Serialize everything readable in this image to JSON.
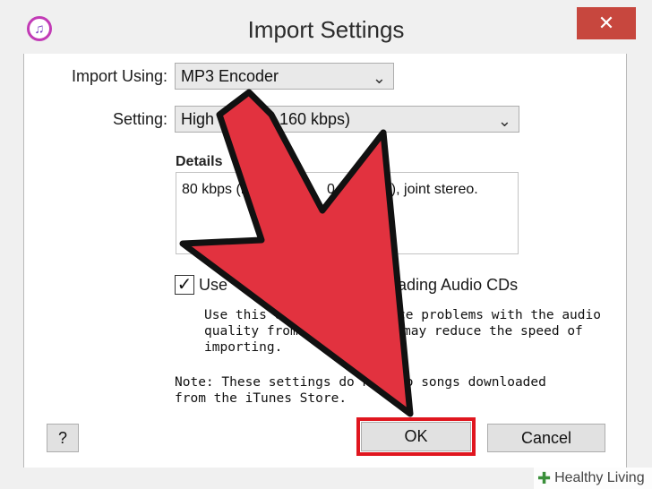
{
  "window": {
    "title": "Import Settings",
    "app_icon_glyph": "♫",
    "close_glyph": "✕"
  },
  "form": {
    "import_using_label": "Import Using:",
    "import_using_value": "MP3 Encoder",
    "setting_label": "Setting:",
    "setting_value_left": "High",
    "setting_value_right": "160 kbps)",
    "dropdown_glyph": "⌄"
  },
  "details": {
    "heading": "Details",
    "text_left": "80 kbps (m",
    "text_middle": "0 k",
    "text_right": "eo), joint stereo."
  },
  "error_correction": {
    "checked_glyph": "✓",
    "label_left": "Use",
    "label_right": "ading Audio CDs",
    "desc_line1_left": "Use this op",
    "desc_line1_right": "ce problems with the audio",
    "desc_line2_left": "quality from A",
    "desc_line2_right": "may reduce the speed of",
    "desc_line3": "importing."
  },
  "note": {
    "line1_left": "Note: These settings do not",
    "line1_right": "to songs downloaded",
    "line2": "from the iTunes Store."
  },
  "buttons": {
    "help": "?",
    "ok": "OK",
    "cancel": "Cancel"
  },
  "watermark": {
    "text": "Healthy Living",
    "cross_glyph": "✚"
  },
  "colors": {
    "arrow_fill": "#e2323f",
    "arrow_stroke": "#111111",
    "highlight": "#e0161f",
    "close_button": "#c7473e"
  }
}
